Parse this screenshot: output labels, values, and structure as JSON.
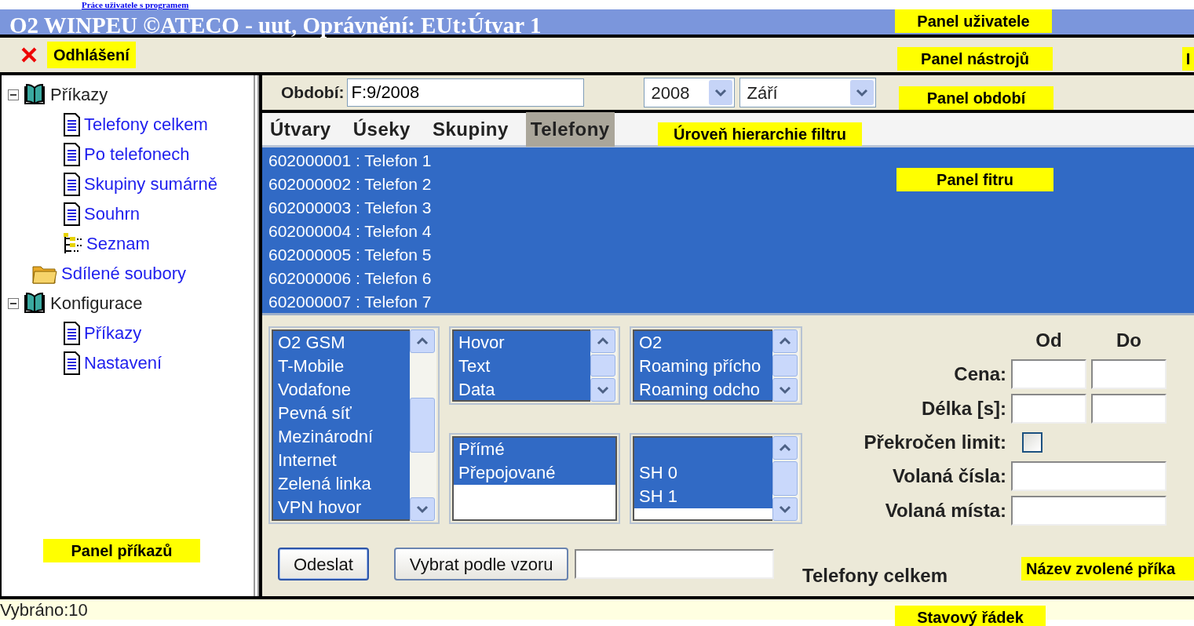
{
  "top_link": "Práce uživatele s programem",
  "title": "O2 WINPEU ©ATECO - uut, Oprávnění: EUt:Útvar 1",
  "toolbar": {
    "logout": "Odhlášení"
  },
  "tree": [
    {
      "label": "Příkazy",
      "kind": "book",
      "expanded": true,
      "children": [
        {
          "label": "Telefony celkem",
          "kind": "document"
        },
        {
          "label": "Po telefonech",
          "kind": "document"
        },
        {
          "label": "Skupiny sumárně",
          "kind": "document"
        },
        {
          "label": "Souhrn",
          "kind": "document"
        },
        {
          "label": "Seznam",
          "kind": "hierarchy"
        }
      ]
    },
    {
      "label": "Sdílené soubory",
      "kind": "folder"
    },
    {
      "label": "Konfigurace",
      "kind": "book",
      "expanded": true,
      "children": [
        {
          "label": "Příkazy",
          "kind": "document"
        },
        {
          "label": "Nastavení",
          "kind": "document"
        }
      ]
    }
  ],
  "period": {
    "label": "Období:",
    "value": "F:9/2008",
    "year": "2008",
    "month": "Září"
  },
  "tabs": [
    {
      "label": "Útvary",
      "selected": false
    },
    {
      "label": "Úseky",
      "selected": false
    },
    {
      "label": "Skupiny",
      "selected": false
    },
    {
      "label": "Telefony",
      "selected": true
    }
  ],
  "filter_items": [
    {
      "label": "602000001 : Telefon 1",
      "selected": true
    },
    {
      "label": "602000002 : Telefon 2",
      "selected": true
    },
    {
      "label": "602000003 : Telefon 3",
      "selected": true
    },
    {
      "label": "602000004 : Telefon 4",
      "selected": true
    },
    {
      "label": "602000005 : Telefon 5",
      "selected": true
    },
    {
      "label": "602000006 : Telefon 6",
      "selected": true
    },
    {
      "label": "602000007 : Telefon 7",
      "selected": true
    }
  ],
  "listboxes": [
    {
      "scrollbar": true,
      "blank_first_row": false,
      "items": [
        {
          "label": "O2 GSM",
          "selected": true
        },
        {
          "label": "T-Mobile",
          "selected": true
        },
        {
          "label": "Vodafone",
          "selected": true
        },
        {
          "label": "Pevná síť",
          "selected": true
        },
        {
          "label": "Mezinárodní",
          "selected": true
        },
        {
          "label": "Internet",
          "selected": true
        },
        {
          "label": "Zelená linka",
          "selected": true
        },
        {
          "label": "VPN hovor",
          "selected": true
        }
      ]
    },
    {
      "scrollbar": true,
      "blank_first_row": false,
      "items": [
        {
          "label": "Hovor",
          "selected": true
        },
        {
          "label": "Text",
          "selected": true
        },
        {
          "label": "Data",
          "selected": true
        }
      ]
    },
    {
      "scrollbar": true,
      "blank_first_row": false,
      "items": [
        {
          "label": "O2",
          "selected": true
        },
        {
          "label": "Roaming přícho",
          "selected": true
        },
        {
          "label": "Roaming odcho",
          "selected": true
        }
      ]
    },
    {
      "scrollbar": false,
      "blank_first_row": false,
      "items": [
        {
          "label": "Přímé",
          "selected": true
        },
        {
          "label": "Přepojované",
          "selected": true
        }
      ]
    },
    {
      "scrollbar": true,
      "blank_first_row": true,
      "items": [
        {
          "label": "SH 0",
          "selected": true
        },
        {
          "label": "SH 1",
          "selected": true
        }
      ]
    }
  ],
  "range_headers": [
    "Od",
    "Do"
  ],
  "fields": [
    {
      "label": "Cena:",
      "kind": "range"
    },
    {
      "label": "Délka [s]:",
      "kind": "range"
    },
    {
      "label": "Překročen limit:",
      "kind": "checkbox",
      "checked": false
    },
    {
      "label": "Volaná čísla:",
      "kind": "text"
    },
    {
      "label": "Volaná místa:",
      "kind": "text"
    }
  ],
  "buttons": [
    {
      "label": "Odeslat",
      "default": true
    },
    {
      "label": "Vybrat podle vzoru",
      "default": false
    }
  ],
  "command_name": "Telefony celkem",
  "status": "Vybráno:10",
  "annotations": [
    "Panel uživatele",
    "Panel nástrojů",
    "I",
    "Panel období",
    "Úroveň hierarchie filtru",
    "Panel fitru",
    "Panel příkazů",
    "Název zvolené příka",
    "Stavový řádek"
  ]
}
